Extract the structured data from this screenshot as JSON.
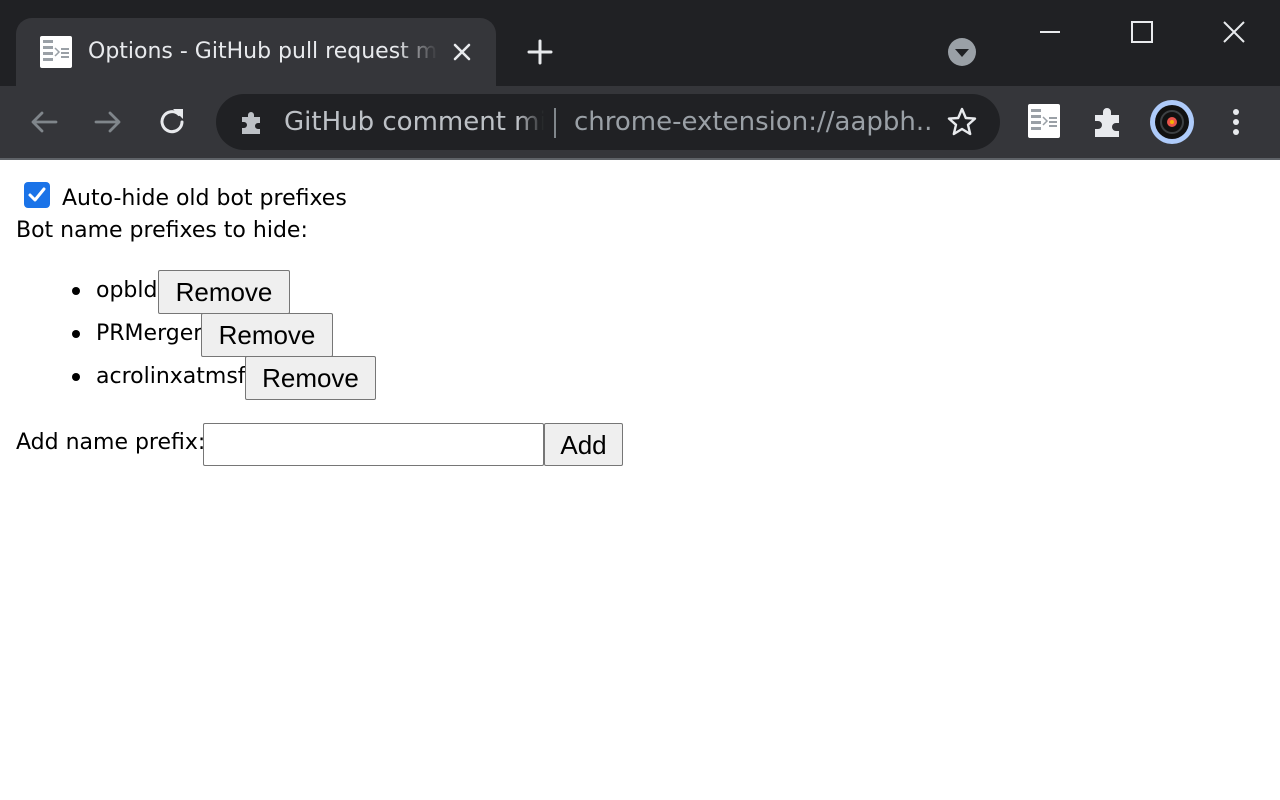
{
  "browser": {
    "tab_title": "Options - GitHub pull request minimizer",
    "omnibox_site_name": "GitHub comment minimizer",
    "omnibox_url": "chrome-extension://aapbh...",
    "accent_color": "#1a73e8"
  },
  "icons": {
    "tab_favicon": "extension-favicon-icon",
    "tab_close": "close-icon",
    "new_tab": "plus-icon",
    "tab_search": "tab-search-icon",
    "back": "back-arrow-icon",
    "forward": "forward-arrow-icon",
    "reload": "reload-icon",
    "site_info": "puzzle-icon",
    "bookmark": "star-icon",
    "extension": "extension-icon",
    "extensions_menu": "puzzle-icon",
    "profile": "avatar",
    "menu": "kebab-menu-icon"
  },
  "options": {
    "autohide_label": "Auto-hide old bot prefixes",
    "autohide_checked": true,
    "prefixes_heading": "Bot name prefixes to hide:",
    "prefixes": [
      {
        "name": "opbld",
        "remove_label": "Remove"
      },
      {
        "name": "PRMerger",
        "remove_label": "Remove"
      },
      {
        "name": "acrolinxatmsft",
        "remove_label": "Remove"
      }
    ],
    "add_label": "Add name prefix:",
    "add_input_value": "",
    "add_button_label": "Add"
  }
}
